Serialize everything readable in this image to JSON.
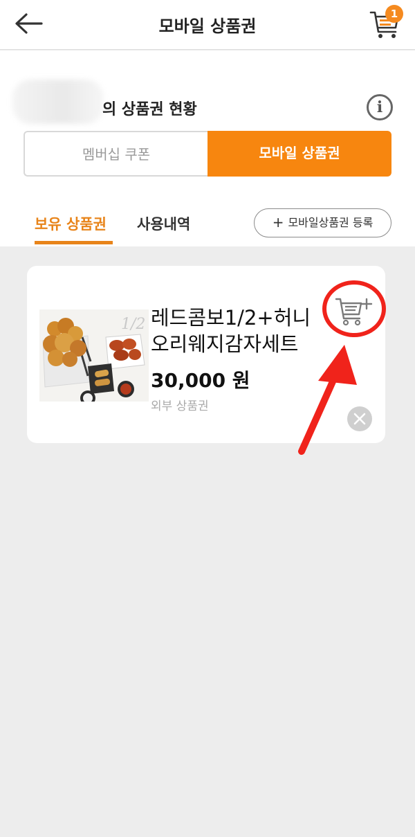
{
  "header": {
    "title": "모바일 상품권",
    "cart_count": "1"
  },
  "status": {
    "title_suffix": "의 상품권 현황"
  },
  "segments": {
    "membership_label": "멤버십 쿠폰",
    "mobile_label": "모바일 상품권",
    "selected": "mobile"
  },
  "tabs": {
    "owned_label": "보유 상품권",
    "history_label": "사용내역",
    "selected": "owned"
  },
  "register": {
    "plus_glyph": "+",
    "label": "모바일상품권 등록"
  },
  "voucher": {
    "name_line1": "레드콤보1/2+허니",
    "name_line2": "오리웨지감자세트",
    "price": "30,000 원",
    "type": "외부 상품권",
    "image_text": "1/2"
  },
  "colors": {
    "accent": "#f7860f",
    "annotation": "#f0231b",
    "background": "#ededed"
  },
  "icons": {
    "back": "arrow-left-icon",
    "cart": "cart-icon",
    "info": "info-icon",
    "add_cart": "cart-plus-icon",
    "delete": "close-circle-icon"
  }
}
